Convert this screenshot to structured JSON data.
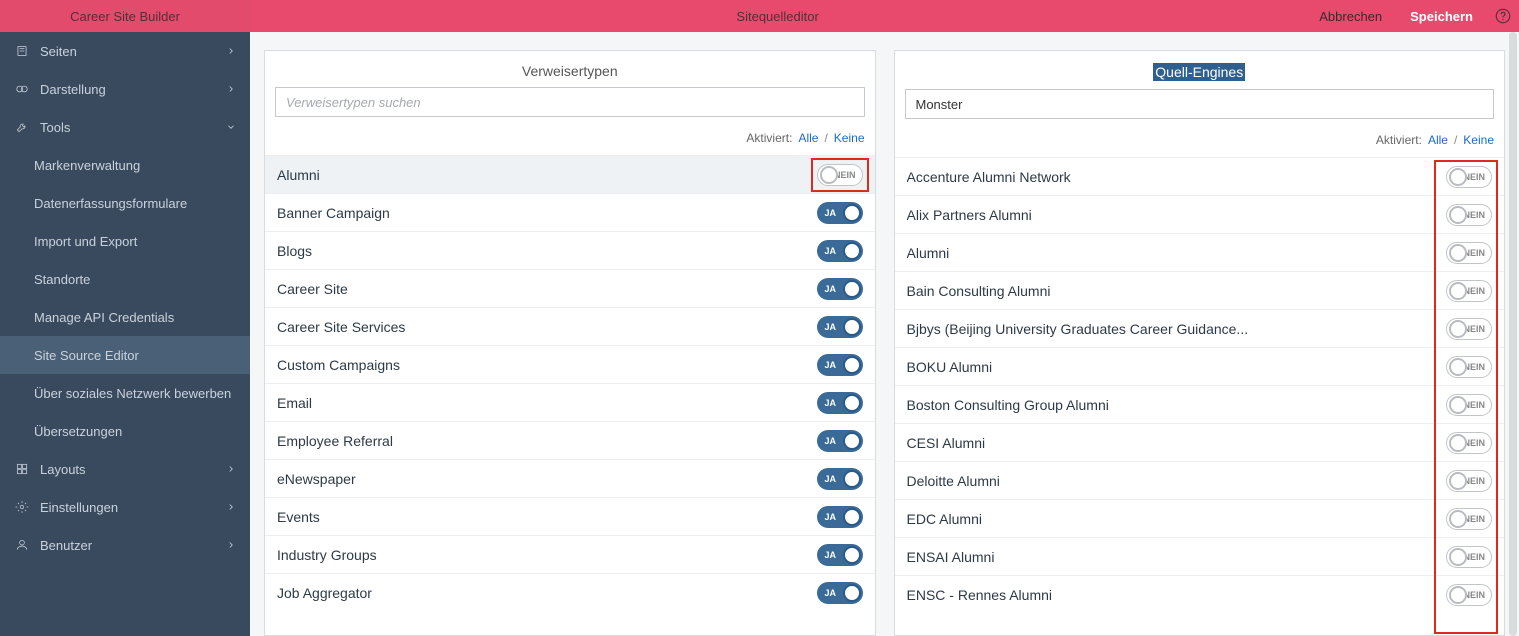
{
  "header": {
    "brand": "Career Site Builder",
    "title": "Sitequelleditor",
    "cancel": "Abbrechen",
    "save": "Speichern"
  },
  "sidebar": {
    "items": [
      {
        "label": "Seiten",
        "icon": "pages"
      },
      {
        "label": "Darstellung",
        "icon": "appearance"
      },
      {
        "label": "Tools",
        "icon": "tools",
        "expanded": true,
        "children": [
          {
            "label": "Markenverwaltung"
          },
          {
            "label": "Datenerfassungsformulare"
          },
          {
            "label": "Import und Export"
          },
          {
            "label": "Standorte"
          },
          {
            "label": "Manage API Credentials"
          },
          {
            "label": "Site Source Editor",
            "active": true
          },
          {
            "label": "Über soziales Netzwerk bewerben"
          },
          {
            "label": "Übersetzungen"
          }
        ]
      },
      {
        "label": "Layouts",
        "icon": "layouts"
      },
      {
        "label": "Einstellungen",
        "icon": "settings"
      },
      {
        "label": "Benutzer",
        "icon": "users"
      }
    ]
  },
  "labels": {
    "activated": "Aktiviert:",
    "all": "Alle",
    "none": "Keine",
    "yes": "JA",
    "no": "NEIN"
  },
  "leftPanel": {
    "title": "Verweisertypen",
    "searchPlaceholder": "Verweisertypen suchen",
    "searchValue": "",
    "rows": [
      {
        "label": "Alumni",
        "on": false,
        "selected": true,
        "highlight": true
      },
      {
        "label": "Banner Campaign",
        "on": true
      },
      {
        "label": "Blogs",
        "on": true
      },
      {
        "label": "Career Site",
        "on": true
      },
      {
        "label": "Career Site Services",
        "on": true
      },
      {
        "label": "Custom Campaigns",
        "on": true
      },
      {
        "label": "Email",
        "on": true
      },
      {
        "label": "Employee Referral",
        "on": true
      },
      {
        "label": "eNewspaper",
        "on": true
      },
      {
        "label": "Events",
        "on": true
      },
      {
        "label": "Industry Groups",
        "on": true
      },
      {
        "label": "Job Aggregator",
        "on": true
      }
    ]
  },
  "rightPanel": {
    "title": "Quell-Engines",
    "titleSelected": true,
    "searchPlaceholder": "",
    "searchValue": "Monster",
    "highlightColumn": true,
    "rows": [
      {
        "label": "Accenture Alumni Network",
        "on": false
      },
      {
        "label": "Alix Partners Alumni",
        "on": false
      },
      {
        "label": "Alumni",
        "on": false
      },
      {
        "label": "Bain Consulting Alumni",
        "on": false
      },
      {
        "label": "Bjbys (Beijing University Graduates Career Guidance...",
        "on": false
      },
      {
        "label": "BOKU Alumni",
        "on": false
      },
      {
        "label": "Boston Consulting Group Alumni",
        "on": false
      },
      {
        "label": "CESI Alumni",
        "on": false
      },
      {
        "label": "Deloitte Alumni",
        "on": false
      },
      {
        "label": "EDC Alumni",
        "on": false
      },
      {
        "label": "ENSAI Alumni",
        "on": false
      },
      {
        "label": "ENSC - Rennes Alumni",
        "on": false
      }
    ]
  }
}
